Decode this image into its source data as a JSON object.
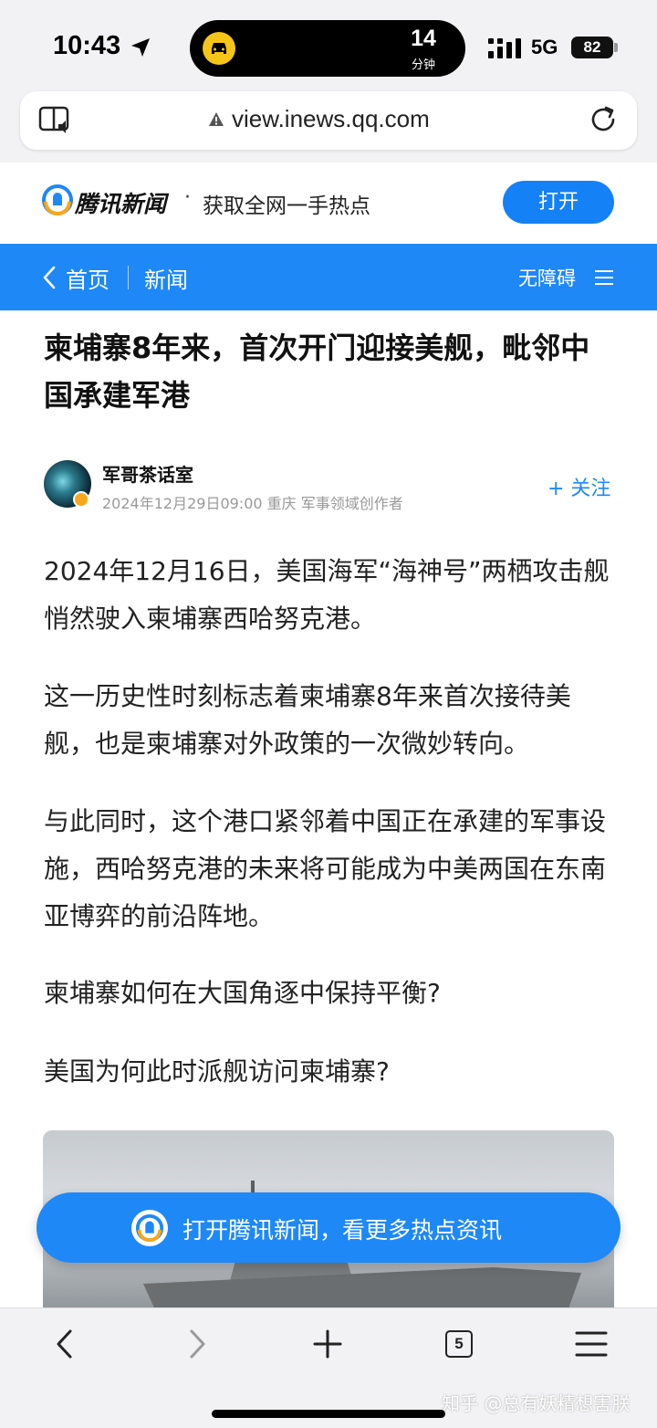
{
  "status_bar": {
    "time": "10:43",
    "island_number": "14",
    "island_unit": "分钟",
    "network": "5G",
    "battery": "82"
  },
  "browser": {
    "url": "view.inews.qq.com"
  },
  "app_banner": {
    "brand": "腾讯新闻",
    "separator": "·",
    "slogan": "获取全网一手热点",
    "open_label": "打开"
  },
  "nav": {
    "home_label": "首页",
    "section_label": "新闻",
    "accessibility_label": "无障碍"
  },
  "article": {
    "title": "柬埔寨8年来，首次开门迎接美舰，毗邻中国承建军港",
    "author": {
      "name": "军哥茶话室",
      "meta": "2024年12月29日09:00  重庆  军事领域创作者",
      "follow_label": "+ 关注"
    },
    "paragraphs": [
      "2024年12月16日，美国海军“海神号”两栖攻击舰悄然驶入柬埔寨西哈努克港。",
      "这一历史性时刻标志着柬埔寨8年来首次接待美舰，也是柬埔寨对外政策的一次微妙转向。",
      "与此同时，这个港口紧邻着中国正在承建的军事设施，西哈努克港的未来将可能成为中美两国在东南亚博弈的前沿阵地。",
      "柬埔寨如何在大国角逐中保持平衡?",
      "美国为何此时派舰访问柬埔寨?"
    ]
  },
  "cta": {
    "text": "打开腾讯新闻，看更多热点资讯"
  },
  "toolbar": {
    "tab_count": "5"
  },
  "watermark": "知乎 @总有妖精想害朕",
  "colors": {
    "accent": "#1e88f7",
    "button": "#1581f6",
    "badge": "#f7a81a"
  }
}
